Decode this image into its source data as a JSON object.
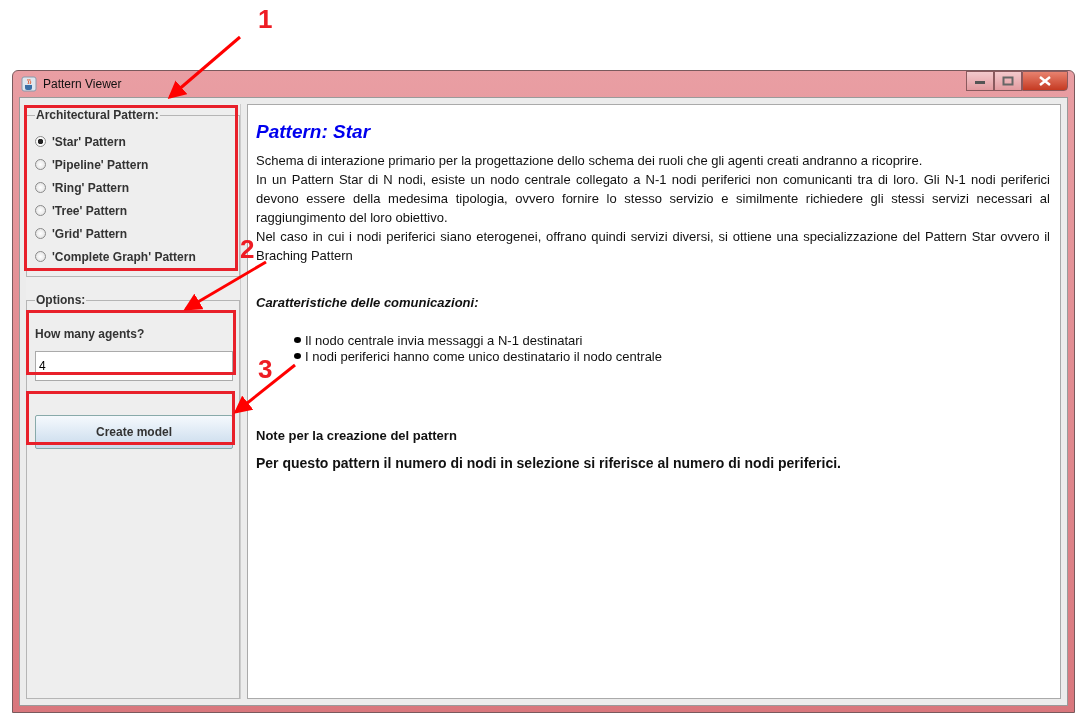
{
  "window": {
    "title": "Pattern Viewer"
  },
  "pattern_group": {
    "title": "Architectural Pattern:",
    "options": [
      {
        "label": "'Star' Pattern",
        "selected": true
      },
      {
        "label": "'Pipeline' Pattern",
        "selected": false
      },
      {
        "label": "'Ring' Pattern",
        "selected": false
      },
      {
        "label": "'Tree' Pattern",
        "selected": false
      },
      {
        "label": "'Grid' Pattern",
        "selected": false
      },
      {
        "label": "'Complete Graph' Pattern",
        "selected": false
      }
    ]
  },
  "options_group": {
    "title": "Options:",
    "agents_label": "How many agents?",
    "agents_value": "4",
    "button": "Create model"
  },
  "content": {
    "heading": "Pattern: Star",
    "paragraphs": [
      "Schema di interazione primario per la progettazione dello schema dei ruoli che gli agenti creati andranno a ricoprire.",
      "In un Pattern Star di N nodi, esiste un nodo centrale collegato a N-1 nodi periferici non comunicanti tra di loro. Gli N-1 nodi periferici devono essere della medesima tipologia, ovvero fornire lo stesso servizio e similmente richiedere gli stessi servizi necessari al raggiungimento del loro obiettivo.",
      "Nel caso in cui i nodi periferici siano eterogenei, offrano quindi servizi diversi, si ottiene una specializzazione del Pattern Star ovvero il Braching Pattern"
    ],
    "features_title": "Caratteristiche delle comunicazioni:",
    "features": [
      "Il nodo centrale invia messaggi a N-1 destinatari",
      "I nodi periferici hanno come unico destinatario il nodo centrale"
    ],
    "notes_title": "Note per la creazione del pattern",
    "notes_text": "Per questo pattern il numero di nodi in selezione si riferisce al numero di nodi periferici."
  },
  "annotations": [
    {
      "label": "1"
    },
    {
      "label": "2"
    },
    {
      "label": "3"
    }
  ]
}
